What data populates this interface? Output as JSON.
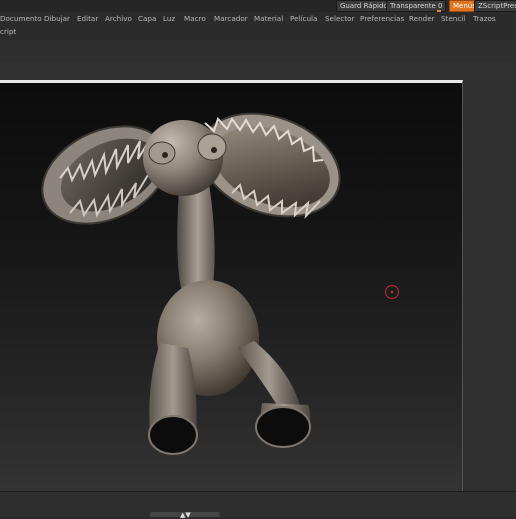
{
  "top_buttons": {
    "quick_save": "Guard Rápido",
    "transparency": "Transparente 0",
    "menus": "Menús",
    "zscript": "ZScriptPred"
  },
  "menu": [
    "Documento",
    "Dibujar",
    "Editar",
    "Archivo",
    "Capa",
    "Luz",
    "Macro",
    "Marcador",
    "Material",
    "Película",
    "Selector",
    "Preferencias",
    "Render",
    "Stencil",
    "Trazos"
  ],
  "menu_row2": [
    "cript"
  ],
  "colors": {
    "accent": "#e0731e",
    "model_base": "#8a8278",
    "cursor_ring": "#c0302a"
  },
  "icons": {
    "brush_cursor": "circle-cursor-icon",
    "collapse_arrow": "chevron-up-down-icon"
  }
}
